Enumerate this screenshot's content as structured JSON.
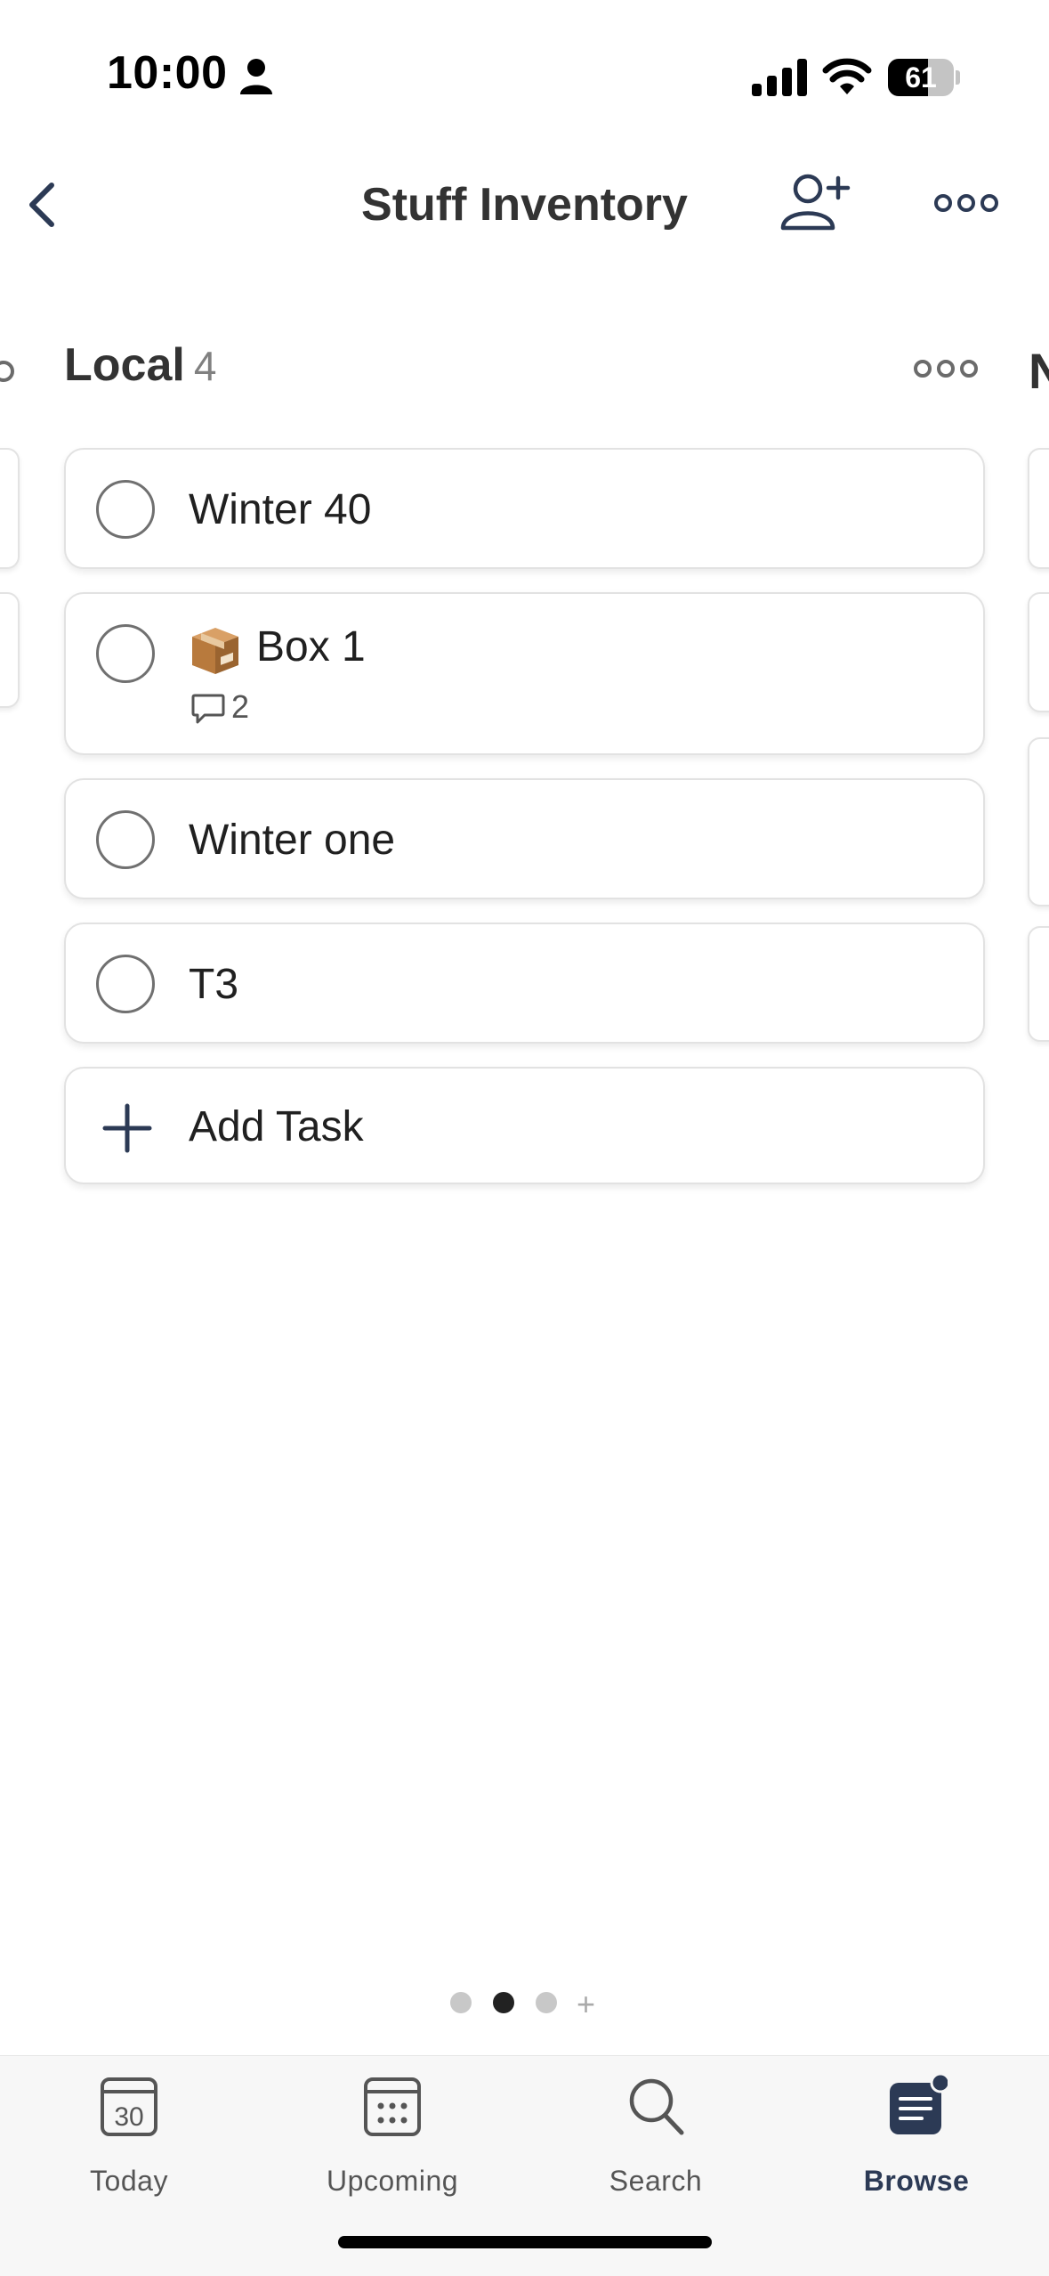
{
  "status_bar": {
    "time": "10:00",
    "battery": "61",
    "battery_level": 0.61
  },
  "header": {
    "title": "Stuff Inventory",
    "back_icon": "chevron-left-icon",
    "share_icon": "person-add-icon",
    "more_icon": "more-horizontal-icon"
  },
  "column": {
    "title": "Local",
    "count": "4",
    "next_column_peek": "N"
  },
  "tasks": [
    {
      "title": "Winter 40"
    },
    {
      "title": "Box 1",
      "emoji": "package",
      "comments": "2"
    },
    {
      "title": "Winter one"
    },
    {
      "title": "T3"
    }
  ],
  "add_task": {
    "label": "Add Task"
  },
  "pager": {
    "pages": 3,
    "active_page": 2
  },
  "nav": {
    "today": {
      "label": "Today",
      "date": "30"
    },
    "upcoming": {
      "label": "Upcoming"
    },
    "search": {
      "label": "Search"
    },
    "browse": {
      "label": "Browse"
    }
  },
  "colors": {
    "accent": "#2c3a55",
    "text": "#202020",
    "muted": "#808080"
  }
}
